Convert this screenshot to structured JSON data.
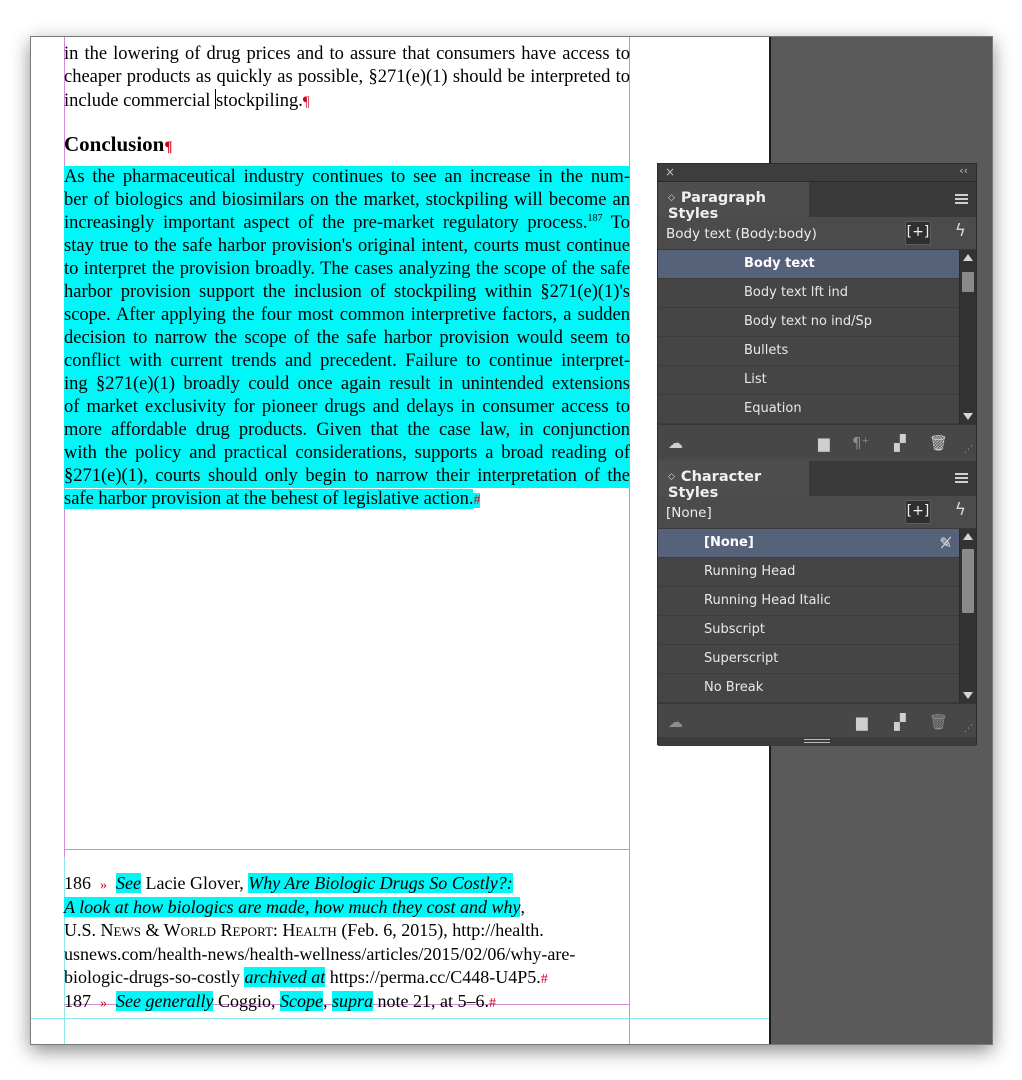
{
  "document": {
    "top_lines": [
      "in the lowering of drug prices and to assure that consumers have access to",
      "cheaper products as quickly as possible, §271(e)(1) should be interpreted to"
    ],
    "top_last_a": "include commercial ",
    "top_last_b": "stockpiling.",
    "heading": "Conclusion",
    "pilcrow": "¶",
    "hash": "#",
    "body_lines": [
      "    As the pharmaceutical industry continues to see an increase in the num-",
      "ber of biologics and biosimilars on the market, stockpiling will become an",
      "increasingly important aspect of the pre-market regulatory process.",
      "stay true to the safe harbor provision's original intent, courts must continue",
      "to interpret the provision broadly. The cases analyzing the scope of the safe",
      "harbor provision support the inclusion of stockpiling within §271(e)(1)'s",
      "scope. After applying the four most common interpretive factors, a sudden",
      "decision to narrow the scope of the safe harbor provision would seem to",
      "conflict with current trends and precedent. Failure to continue interpret-",
      "ing §271(e)(1) broadly could once again result in unintended extensions",
      "of market exclusivity for pioneer drugs and delays in consumer access to",
      "more affordable drug products. Given that the case law, in conjunction",
      "with the policy and practical considerations, supports a broad reading of",
      "§271(e)(1), courts should only begin to narrow their interpretation of the",
      "safe harbor provision at the behest of legislative action."
    ],
    "footnote_ref": "187",
    "line3_tail": " To",
    "footnotes": {
      "fn186_num": "186",
      "fn186_see": "See",
      "fn186_author": " Lacie Glover, ",
      "fn186_title1": "Why Are Biologic Drugs So Costly?: ",
      "fn186_title2": "A look at how biologics are made, how much they cost and why",
      "fn186_pub": "U.S. News & World Report: Health",
      "fn186_date": " (Feb. 6, 2015), http://health.",
      "fn186_url": "usnews.com/health-news/health-wellness/articles/2015/02/06/why-are-",
      "fn186_url2": "biologic-drugs-so-costly ",
      "fn186_archived": "archived at",
      "fn186_perma": " https://perma.cc/C448-U4P5.",
      "fn187_num": "187",
      "fn187_see": "See generally",
      "fn187_author": " Coggio, ",
      "fn187_scope": "Scope",
      "fn187_supra": "supra",
      "fn187_rest": " note 21, at 5–6.",
      "tab_mark": "»"
    }
  },
  "paragraph_styles": {
    "tab_label": "Paragraph Styles",
    "current": "Body text (Body:body)",
    "new_group_glyph": "[+]",
    "items": [
      "Body text",
      "Body text lft ind",
      "Body text no ind/Sp",
      "Bullets",
      "List",
      "Equation"
    ],
    "selected_index": 0
  },
  "character_styles": {
    "tab_label": "Character Styles",
    "current": "[None]",
    "new_group_glyph": "[+]",
    "items": [
      "[None]",
      "Running Head",
      "Running Head Italic",
      "Subscript",
      "Superscript",
      "No Break"
    ],
    "selected_index": 0
  },
  "panel_chrome": {
    "close_glyph": "×",
    "collapse_glyph": "‹‹",
    "bolt_glyph": "ϟ"
  },
  "colors": {
    "highlight": "#00f7f7",
    "hidden_char": "#d0021b",
    "panel_bg": "#4b4b4b",
    "selection": "#56617a"
  }
}
